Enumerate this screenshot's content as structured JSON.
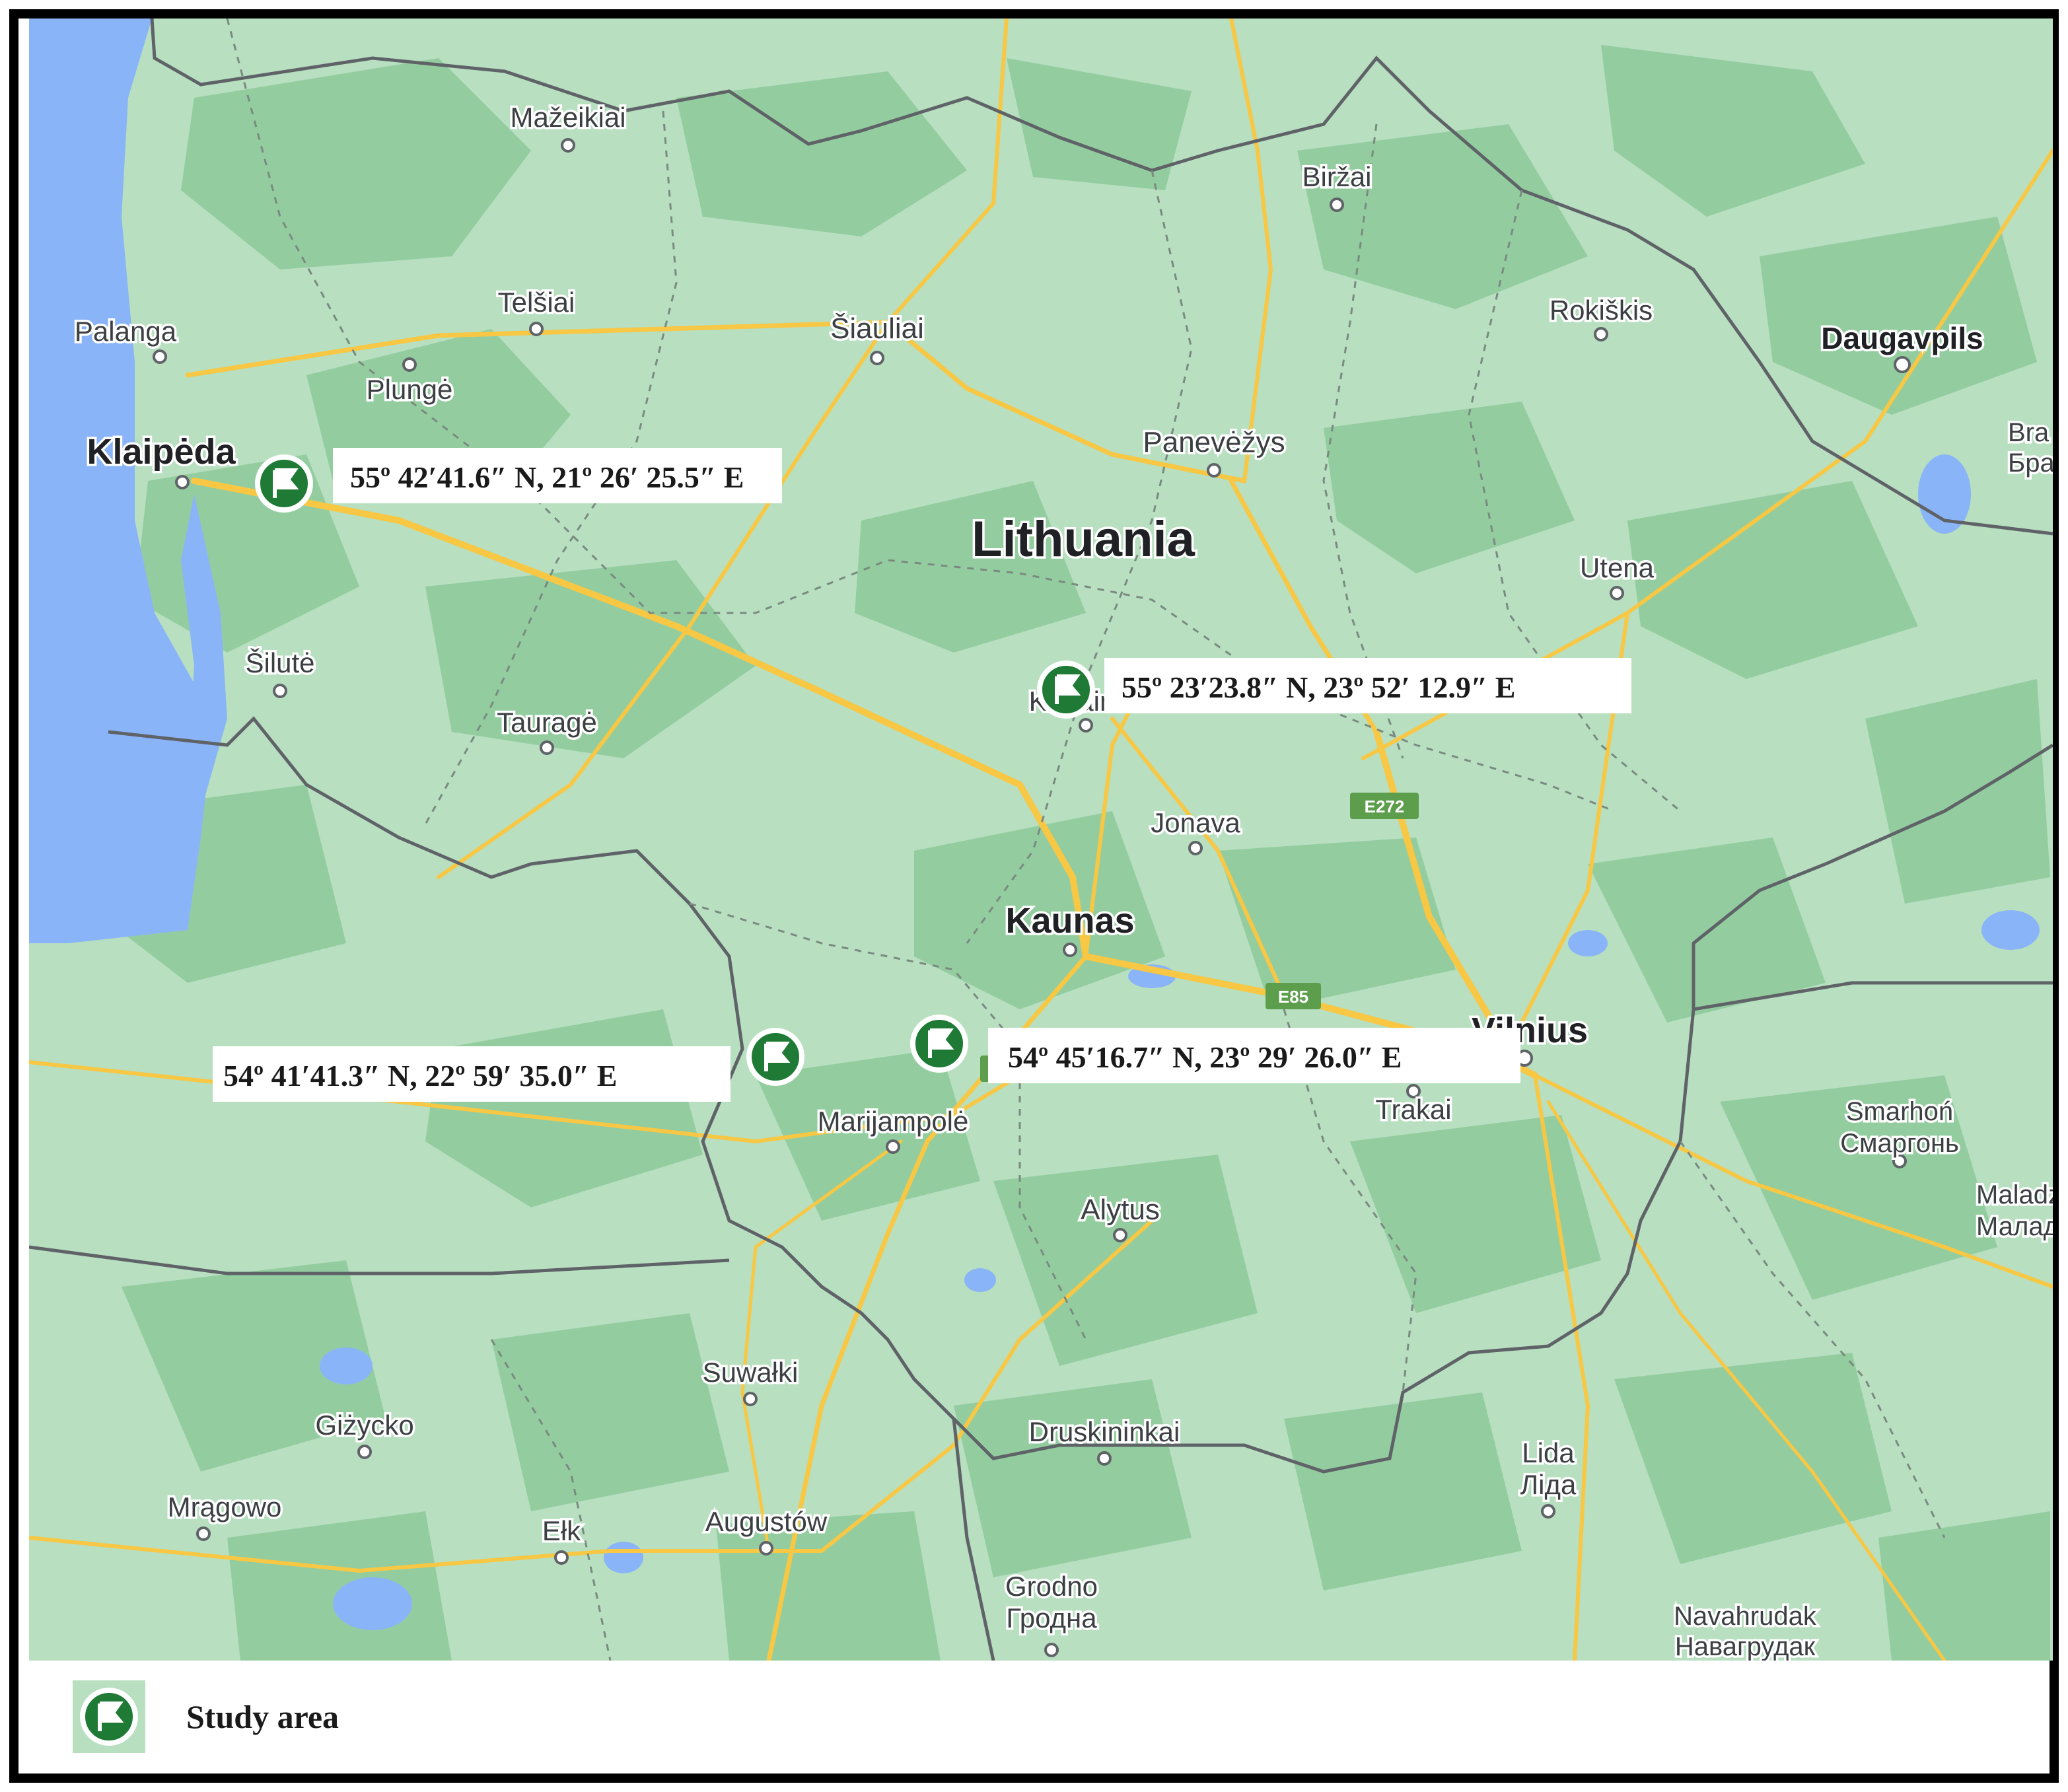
{
  "map": {
    "country_label": "Lithuania",
    "colors": {
      "land": "#b7dfc0",
      "forest": "#93cd9f",
      "water": "#8ab4f8",
      "road": "#f8c744",
      "border": "#5f6368",
      "marker": "#1e7a34"
    },
    "cities": [
      {
        "id": "mazeikiai",
        "name": "Mažeikiai"
      },
      {
        "id": "birzai",
        "name": "Biržai"
      },
      {
        "id": "telsiai",
        "name": "Telšiai"
      },
      {
        "id": "siauliai",
        "name": "Šiauliai"
      },
      {
        "id": "rokiskis",
        "name": "Rokiškis"
      },
      {
        "id": "daugavpils",
        "name": "Daugavpils"
      },
      {
        "id": "palanga",
        "name": "Palanga"
      },
      {
        "id": "plunge",
        "name": "Plungė"
      },
      {
        "id": "klaipeda",
        "name": "Klaipėda"
      },
      {
        "id": "panevezys",
        "name": "Panevėžys"
      },
      {
        "id": "utena",
        "name": "Utena"
      },
      {
        "id": "silute",
        "name": "Šilutė"
      },
      {
        "id": "taurage",
        "name": "Tauragė"
      },
      {
        "id": "kedainiai",
        "name": "Kėdainiai"
      },
      {
        "id": "jonava",
        "name": "Jonava"
      },
      {
        "id": "kaunas",
        "name": "Kaunas"
      },
      {
        "id": "vilnius",
        "name": "Vilnius"
      },
      {
        "id": "trakai",
        "name": "Trakai"
      },
      {
        "id": "marijampole",
        "name": "Marijampolė"
      },
      {
        "id": "smarhon",
        "name": "Smarhoń"
      },
      {
        "id": "smarhon-cyr",
        "name": "Смаргонь"
      },
      {
        "id": "maladz",
        "name": "Maladz"
      },
      {
        "id": "maladz-cyr",
        "name": "Малад"
      },
      {
        "id": "alytus",
        "name": "Alytus"
      },
      {
        "id": "suwalki",
        "name": "Suwałki"
      },
      {
        "id": "gizycko",
        "name": "Giżycko"
      },
      {
        "id": "mragowo",
        "name": "Mrągowo"
      },
      {
        "id": "druskininkai",
        "name": "Druskininkai"
      },
      {
        "id": "lida",
        "name": "Lida"
      },
      {
        "id": "lida-cyr",
        "name": "Ліда"
      },
      {
        "id": "elk",
        "name": "Ełk"
      },
      {
        "id": "augustow",
        "name": "Augustów"
      },
      {
        "id": "grodno",
        "name": "Grodno"
      },
      {
        "id": "grodno-cyr",
        "name": "Гродна"
      },
      {
        "id": "navahrudak",
        "name": "Navahrudak"
      },
      {
        "id": "navahrudak-cyr",
        "name": "Навагрудак"
      },
      {
        "id": "bra",
        "name": "Bra"
      },
      {
        "id": "bra-cyr",
        "name": "Бра"
      }
    ],
    "road_shields": [
      "E272",
      "E85",
      "E"
    ],
    "study_sites": [
      {
        "id": "site-klaipeda",
        "coords": "55º 42′41.6″ N, 21º 26′ 25.5″ E"
      },
      {
        "id": "site-kedainiai",
        "coords": "55º 23′23.8″ N, 23º 52′ 12.9″ E"
      },
      {
        "id": "site-sw",
        "coords": "54º 41′41.3″ N, 22º 59′ 35.0″ E"
      },
      {
        "id": "site-kaunas",
        "coords": "54º 45′16.7″ N, 23º 29′ 26.0″ E"
      }
    ]
  },
  "legend": {
    "icon": "study-area-flag-icon",
    "label": "Study area"
  }
}
